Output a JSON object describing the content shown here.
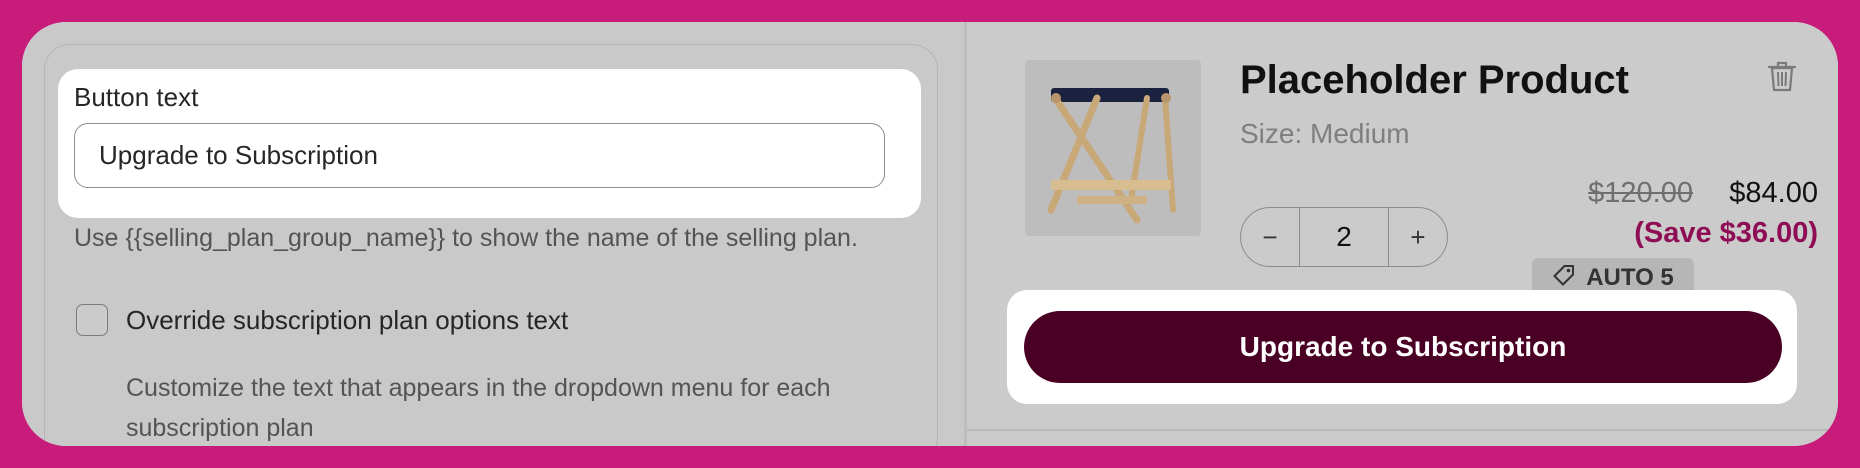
{
  "settings": {
    "field_label": "Button text",
    "button_text_value": "Upgrade to Subscription",
    "help_text": "Use {{selling_plan_group_name}} to show the name of the selling plan.",
    "override_checkbox_label": "Override subscription plan options text",
    "override_checkbox_checked": false,
    "override_description": "Customize the text that appears in the dropdown menu for each subscription plan"
  },
  "cart_item": {
    "title": "Placeholder Product",
    "variant": "Size: Medium",
    "quantity": "2",
    "decrement_label": "−",
    "increment_label": "+",
    "compare_price": "$120.00",
    "price": "$84.00",
    "savings": "(Save $36.00)",
    "discount_code": "AUTO 5",
    "image_icon": "product-image-stool",
    "delete_icon": "trash-icon",
    "subscribe_button_label": "Upgrade to Subscription"
  },
  "colors": {
    "background": "#c81c7a",
    "button": "#4a0025",
    "savings": "#8e0d54"
  }
}
